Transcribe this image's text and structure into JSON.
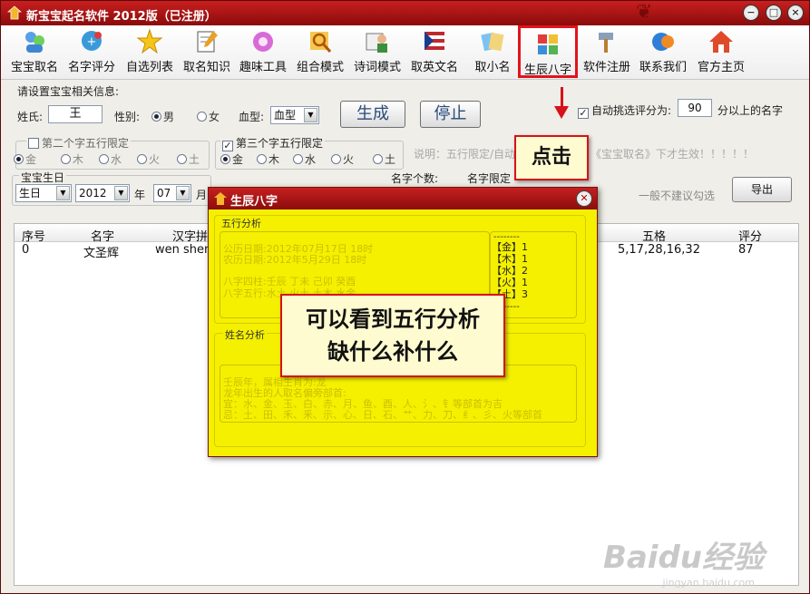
{
  "window": {
    "title": "新宝宝起名软件 2012版（已注册）"
  },
  "toolbar": {
    "items": [
      {
        "label": "宝宝取名",
        "icon": "babies-icon"
      },
      {
        "label": "名字评分",
        "icon": "score-icon"
      },
      {
        "label": "自选列表",
        "icon": "star-list-icon"
      },
      {
        "label": "取名知识",
        "icon": "notebook-icon"
      },
      {
        "label": "趣味工具",
        "icon": "gear-flower-icon"
      },
      {
        "label": "组合模式",
        "icon": "magnifier-icon"
      },
      {
        "label": "诗词模式",
        "icon": "poem-icon"
      },
      {
        "label": "取英文名",
        "icon": "flag-icon"
      },
      {
        "label": "取小名",
        "icon": "cards-icon"
      },
      {
        "label": "生辰八字",
        "icon": "bazi-icon"
      },
      {
        "label": "软件注册",
        "icon": "hammer-icon"
      },
      {
        "label": "联系我们",
        "icon": "contact-icon"
      },
      {
        "label": "官方主页",
        "icon": "home-icon"
      }
    ]
  },
  "form": {
    "section_label": "请设置宝宝相关信息:",
    "surname_label": "姓氏:",
    "surname_value": "王",
    "gender_label": "性别:",
    "gender_male": "男",
    "gender_female": "女",
    "blood_label": "血型:",
    "blood_value": "血型",
    "generate_button": "生成",
    "stop_button": "停止",
    "auto_pick_label": "自动挑选评分为:",
    "auto_pick_value": "90",
    "auto_pick_suffix": "分以上的名字",
    "second_char_label": "第二个字五行限定",
    "third_char_label": "第三个字五行限定",
    "elements": [
      "金",
      "木",
      "水",
      "火",
      "土"
    ],
    "note_text": "说明：五行限定/自动",
    "note_text_2": "《宝宝取名》下才生效！！！！！",
    "birthday_label": "宝宝生日",
    "birth_type": "生日",
    "birth_year": "2012",
    "year_unit": "年",
    "birth_month": "07",
    "month_unit": "月",
    "name_count_label": "名字个数:",
    "name_limit_label": "名字限定",
    "not_recommended": "一般不建议勾选",
    "export_button": "导出"
  },
  "grid": {
    "columns": [
      "序号",
      "名字",
      "汉字拼",
      "五格",
      "评分"
    ],
    "rows": [
      {
        "index": "0",
        "name": "文圣辉",
        "pinyin": "wen shen",
        "wuge": "5,17,28,16,32",
        "score": "87"
      }
    ]
  },
  "dialog": {
    "title": "生辰八字",
    "wuxing_section": "五行分析",
    "solar_date": "公历日期:2012年07月17日 18时",
    "lunar_date": "农历日期:2012年5月29日 18时",
    "bazi_pillars": "八字四柱:壬辰 丁未 己卯 癸酉",
    "bazi_wuxing": "八字五行:水土 火土 土木 水金",
    "dashes": "--------",
    "counts": [
      {
        "el": "【金】",
        "n": "1"
      },
      {
        "el": "【木】",
        "n": "1"
      },
      {
        "el": "【水】",
        "n": "2"
      },
      {
        "el": "【火】",
        "n": "1"
      },
      {
        "el": "【土】",
        "n": "3"
      }
    ],
    "dashes_bottom": "--------",
    "name_section": "姓名分析",
    "name_line_1": "壬辰年，属相生肖为:龙",
    "name_line_2": "龙年出生的人取名偏旁部首:",
    "name_line_3": "宜：水、金、玉、白、赤、月、鱼、酉、人、氵、钅等部首为吉",
    "name_line_4": "忌：土、田、禾、釆、示、心、日、石、艹、力、刀、纟、彡、火等部首"
  },
  "annotations": {
    "click_label": "点击",
    "callout_line_1": "可以看到五行分析",
    "callout_line_2": "缺什么补什么"
  },
  "watermark": {
    "brand": "Baidu经验",
    "url": "jingyan.baidu.com"
  },
  "colors": {
    "titlebar": "#a81515",
    "dialog_bg": "#f5f000",
    "annotation_red": "#d7121a"
  }
}
